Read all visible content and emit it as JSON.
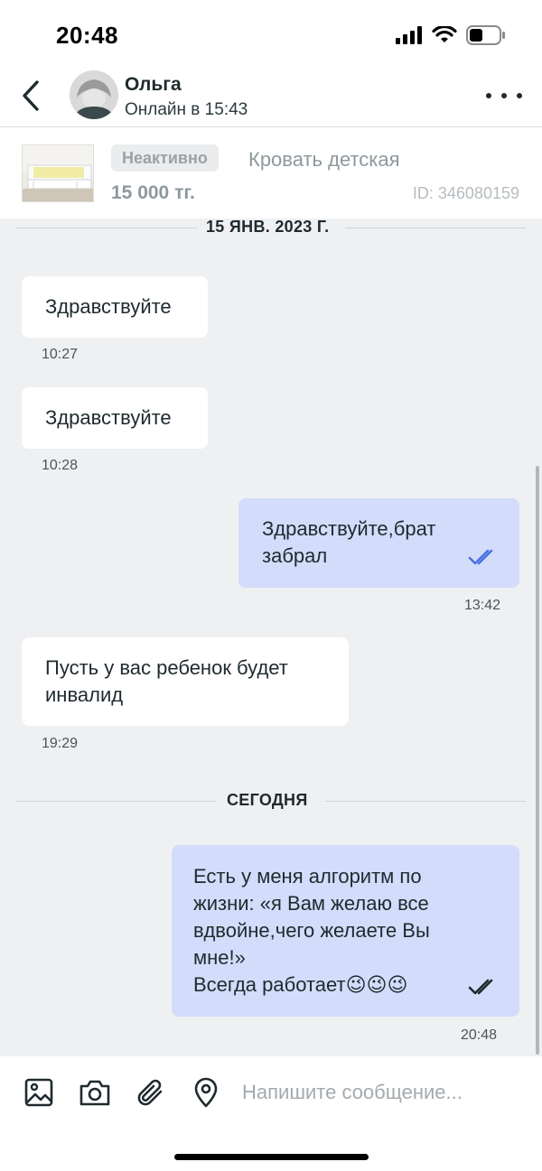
{
  "status_bar": {
    "time": "20:48"
  },
  "header": {
    "contact_name": "Ольга",
    "contact_status": "Онлайн в 15:43"
  },
  "product": {
    "badge": "Неактивно",
    "title": "Кровать детская",
    "price": "15 000 тг.",
    "id": "ID: 346080159"
  },
  "chat": {
    "separators": [
      "15 ЯНВ. 2023 Г.",
      "СЕГОДНЯ"
    ],
    "messages": [
      {
        "direction": "in",
        "lines": [
          "Здравствуйте"
        ],
        "time": "10:27"
      },
      {
        "direction": "in",
        "lines": [
          "Здравствуйте"
        ],
        "time": "10:28"
      },
      {
        "direction": "out",
        "lines": [
          "Здравствуйте,брат",
          "забрал"
        ],
        "time": "13:42",
        "status": "read"
      },
      {
        "direction": "in",
        "lines": [
          "Пусть у вас ребенок будет",
          "инвалид"
        ],
        "time": "19:29"
      },
      {
        "direction": "out",
        "lines": [
          "Есть у меня алгоритм по",
          "жизни: «я Вам желаю все",
          "вдвойне,чего желаете Вы",
          "мне!»",
          "Всегда работает😉😉😉"
        ],
        "time": "20:48",
        "status": "read"
      }
    ]
  },
  "input": {
    "placeholder": "Напишите сообщение..."
  },
  "colors": {
    "incoming_bubble": "#ffffff",
    "outgoing_bubble": "#d3dcfa",
    "chat_background": "#eff0f2",
    "read_tick_blue": "#4a72e0",
    "read_tick_dark": "#1f2a2e"
  },
  "icons": {
    "back": "chevron-left-icon",
    "more": "more-dots-icon",
    "gallery": "image-icon",
    "camera": "camera-icon",
    "attach": "paperclip-icon",
    "location": "location-pin-icon"
  }
}
